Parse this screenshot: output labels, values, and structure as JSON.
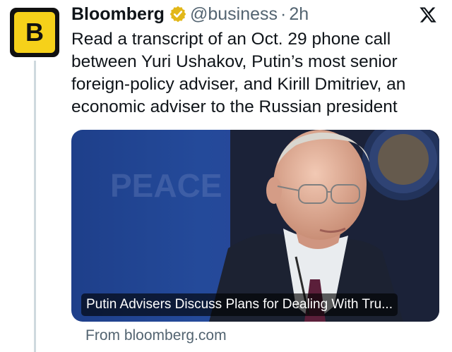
{
  "author": {
    "avatar_letter": "B",
    "avatar_bg": "#f6d11a",
    "name": "Bloomberg",
    "verified_badge_color": "#e2b719",
    "handle": "@business",
    "separator": "·",
    "time": "2h"
  },
  "tweet": {
    "text": "Read a transcript of an Oct. 29 phone call between Yuri Ushakov, Putin’s most senior foreign-policy adviser, and Kirill Dmitriev, an economic adviser to the Russian president"
  },
  "card": {
    "backdrop_text": "PEACE",
    "title": "Putin Advisers Discuss Plans for Dealing With Tru...",
    "source": "From bloomberg.com"
  },
  "icons": {
    "platform": "x-logo-icon",
    "verified": "verified-badge-icon"
  }
}
